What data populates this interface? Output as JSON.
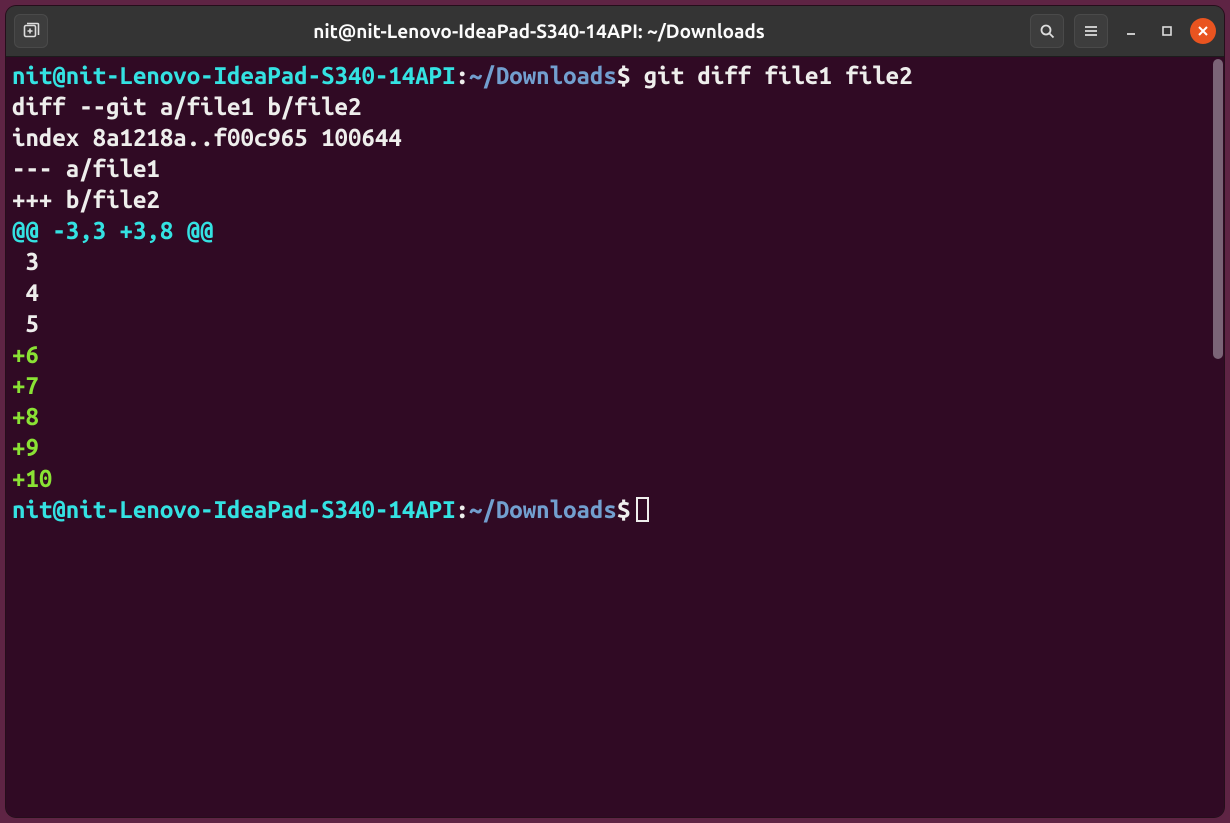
{
  "window": {
    "title": "nit@nit-Lenovo-IdeaPad-S340-14API: ~/Downloads"
  },
  "prompt": {
    "user_host": "nit@nit-Lenovo-IdeaPad-S340-14API",
    "sep": ":",
    "path": "~/Downloads",
    "dollar": "$"
  },
  "command": " git diff file1 file2",
  "diff": {
    "header": "diff --git a/file1 b/file2",
    "index": "index 8a1218a..f00c965 100644",
    "from": "--- a/file1",
    "to": "+++ b/file2",
    "hunk": "@@ -3,3 +3,8 @@",
    "context": [
      " 3",
      " 4",
      " 5"
    ],
    "added": [
      "+6",
      "+7",
      "+8",
      "+9",
      "+10"
    ]
  }
}
